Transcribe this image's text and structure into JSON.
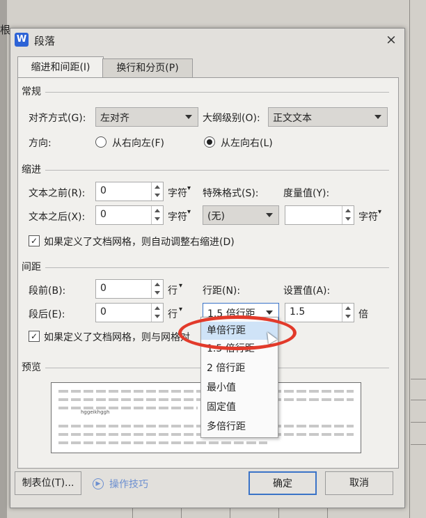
{
  "background": {
    "text_left_top": "根"
  },
  "dialog": {
    "title": "段落",
    "close_icon": "×"
  },
  "tabs": [
    {
      "label": "缩进和间距(I)",
      "active": true
    },
    {
      "label": "换行和分页(P)",
      "active": false
    }
  ],
  "general": {
    "section": "常规",
    "align_label": "对齐方式(G):",
    "align_value": "左对齐",
    "outline_label": "大纲级别(O):",
    "outline_value": "正文文本",
    "direction_label": "方向:",
    "rtl_label": "从右向左(F)",
    "ltr_label": "从左向右(L)",
    "direction_selected": "ltr"
  },
  "indent": {
    "section": "缩进",
    "before_label": "文本之前(R):",
    "before_value": "0",
    "before_unit": "字符",
    "after_label": "文本之后(X):",
    "after_value": "0",
    "after_unit": "字符",
    "special_label": "特殊格式(S):",
    "special_value": "(无)",
    "measure_label": "度量值(Y):",
    "measure_value": "",
    "measure_unit": "字符",
    "auto_adjust_label": "如果定义了文档网格，则自动调整右缩进(D)",
    "auto_adjust_checked": true
  },
  "spacing": {
    "section": "间距",
    "before_label": "段前(B):",
    "before_value": "0",
    "before_unit": "行",
    "after_label": "段后(E):",
    "after_value": "0",
    "after_unit": "行",
    "line_label": "行距(N):",
    "line_value": "1.5 倍行距",
    "set_label": "设置值(A):",
    "set_value": "1.5",
    "set_unit": "倍",
    "grid_label": "如果定义了文档网格，则与网格对",
    "grid_checked": true
  },
  "preview": {
    "section": "预览",
    "sample": "hggeikhggh"
  },
  "line_spacing_options": [
    "单倍行距",
    "1.5 倍行距",
    "2 倍行距",
    "最小值",
    "固定值",
    "多倍行距"
  ],
  "selected_option_index": 0,
  "footer": {
    "tabs_button": "制表位(T)...",
    "tips_link": "操作技巧",
    "ok_button": "确定",
    "cancel_button": "取消"
  },
  "colors": {
    "highlight_ellipse": "#e23a2a",
    "selected_option": "#cfe3f7",
    "primary_border": "#3a73c7"
  }
}
